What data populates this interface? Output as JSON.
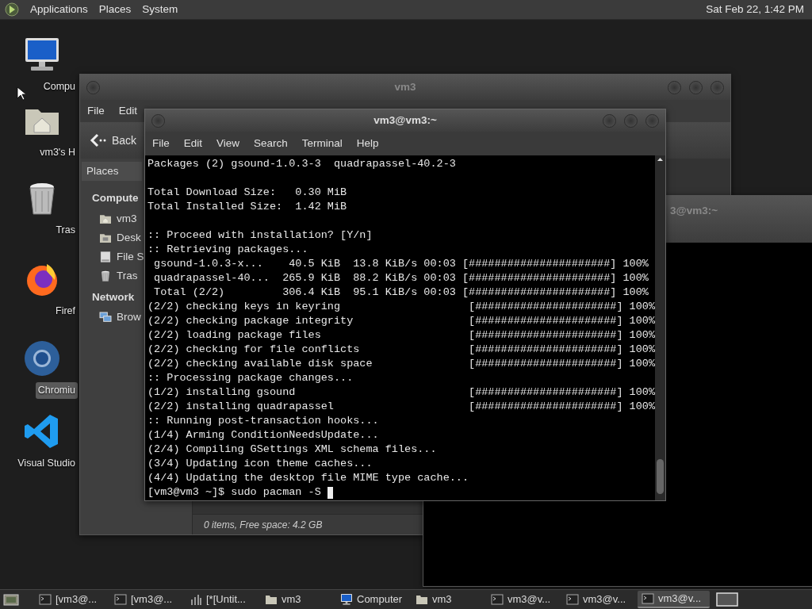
{
  "top_panel": {
    "menus": [
      "Applications",
      "Places",
      "System"
    ],
    "clock": "Sat Feb 22, 1:42 PM"
  },
  "desktop_icons": [
    {
      "kind": "computer",
      "label": "Compu",
      "selected": false
    },
    {
      "kind": "home",
      "label": "vm3's H",
      "selected": false
    },
    {
      "kind": "trash",
      "label": "Tras",
      "selected": false
    },
    {
      "kind": "firefox",
      "label": "Firef",
      "selected": false
    },
    {
      "kind": "chromium",
      "label": "Chromiu",
      "selected": true
    },
    {
      "kind": "vscode",
      "label": "Visual Studio",
      "selected": false
    }
  ],
  "file_manager": {
    "title": "vm3",
    "menu": [
      "File",
      "Edit"
    ],
    "back": "Back",
    "sidebar_header": "Places",
    "sections": [
      {
        "heading": "Compute",
        "items": [
          {
            "kind": "home",
            "label": "vm3"
          },
          {
            "kind": "desktop",
            "label": "Desk"
          },
          {
            "kind": "drive",
            "label": "File S"
          },
          {
            "kind": "trash",
            "label": "Tras"
          }
        ]
      },
      {
        "heading": "Network",
        "items": [
          {
            "kind": "network",
            "label": "Brow"
          }
        ]
      }
    ],
    "status": "0 items, Free space: 4.2 GB"
  },
  "back_terminal": {
    "title": "3@vm3:~"
  },
  "terminal": {
    "title": "vm3@vm3:~",
    "menu": [
      "File",
      "Edit",
      "View",
      "Search",
      "Terminal",
      "Help"
    ],
    "blocks": [
      [
        "Packages (2) gsound-1.0.3-3  quadrapassel-40.2-3"
      ],
      [
        "Total Download Size:   0.30 MiB",
        "Total Installed Size:  1.42 MiB"
      ],
      [
        ":: Proceed with installation? [Y/n]",
        ":: Retrieving packages...",
        " gsound-1.0.3-x...    40.5 KiB  13.8 KiB/s 00:03 [######################] 100%",
        " quadrapassel-40...  265.9 KiB  88.2 KiB/s 00:03 [######################] 100%",
        " Total (2/2)         306.4 KiB  95.1 KiB/s 00:03 [######################] 100%",
        "(2/2) checking keys in keyring                    [######################] 100%",
        "(2/2) checking package integrity                  [######################] 100%",
        "(2/2) loading package files                       [######################] 100%",
        "(2/2) checking for file conflicts                 [######################] 100%",
        "(2/2) checking available disk space               [######################] 100%",
        ":: Processing package changes...",
        "(1/2) installing gsound                           [######################] 100%",
        "(2/2) installing quadrapassel                     [######################] 100%",
        ":: Running post-transaction hooks...",
        "(1/4) Arming ConditionNeedsUpdate...",
        "(2/4) Compiling GSettings XML schema files...",
        "(3/4) Updating icon theme caches...",
        "(4/4) Updating the desktop file MIME type cache..."
      ]
    ],
    "prompt": "[vm3@vm3 ~]$ sudo pacman -S"
  },
  "taskbar": {
    "items": [
      {
        "kind": "terminal",
        "label": "[vm3@...",
        "selected": false
      },
      {
        "kind": "terminal",
        "label": "[vm3@...",
        "selected": false
      },
      {
        "kind": "chart",
        "label": "[*[Untit...",
        "selected": false
      },
      {
        "kind": "folder",
        "label": "vm3",
        "selected": false
      },
      {
        "kind": "computer",
        "label": "Computer",
        "selected": false
      },
      {
        "kind": "folder",
        "label": "vm3",
        "selected": false
      },
      {
        "kind": "terminal",
        "label": "vm3@v...",
        "selected": false
      },
      {
        "kind": "terminal",
        "label": "vm3@v...",
        "selected": false
      },
      {
        "kind": "terminal",
        "label": "vm3@v...",
        "selected": true
      }
    ]
  }
}
